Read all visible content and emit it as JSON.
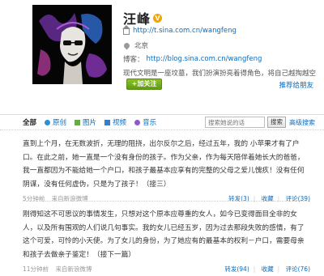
{
  "profile": {
    "name": "汪峰",
    "verified_badge": "V",
    "url": "http://t.sina.com.cn/wangfeng",
    "location": "北京",
    "blog_label": "博客：",
    "blog_url": "http://blog.sina.com.cn/wangfeng",
    "description": "现代文明是一座坟墓，我们扮演扮亮着得角色，将自己越掏越空",
    "follow_button": "+加关注",
    "recommend_link": "推荐给朋友"
  },
  "filter": {
    "tabs": [
      {
        "label": "全部",
        "icon": ""
      },
      {
        "label": "原创",
        "icon": "original-icon"
      },
      {
        "label": "图片",
        "icon": "image-icon"
      },
      {
        "label": "视频",
        "icon": "video-icon"
      },
      {
        "label": "音乐",
        "icon": "music-icon"
      }
    ],
    "search_placeholder": "搜索她说的话",
    "search_button": "搜索",
    "advanced_search": "高级搜索"
  },
  "posts": [
    {
      "text": "直到上个月，在无数波折，无理的阻挠，出尔反尔之后，经过五年，我的 小苹果才有了户口。在此之前，她一直是一个没有身份的孩子。作为父亲，作为每天陪伴着她长大的爸爸，我一直都因为不能给她一个户口，和孩子最基本应享有的完整的父母之爱儿愧疚！没有任何阴谋，没有任何虚伪，只是为了孩子！（接三）",
      "time": "5分钟前",
      "source": "来自新浪微博",
      "actions": {
        "forward": "转发(3)",
        "favorite": "收藏",
        "comment": "评论(39)"
      }
    },
    {
      "text": "刚得知这不可思议的事情发生，只想对这个原本应尊重的女人，如今已变得面目全非的女人，以及所有围观的人们说几句事实。我的女儿已经五岁，因为过去那段失败的感情，有了这个可爱，可怜的小天使。为了女儿的身份，为了她应有的最基本的权利－户口，需要母亲和孩子去做亲子鉴定！（接下一篇）",
      "time": "11分钟前",
      "source": "来自新浪微博",
      "actions": {
        "forward": "转发(94)",
        "favorite": "收藏",
        "comment": "评论(76)"
      }
    }
  ]
}
